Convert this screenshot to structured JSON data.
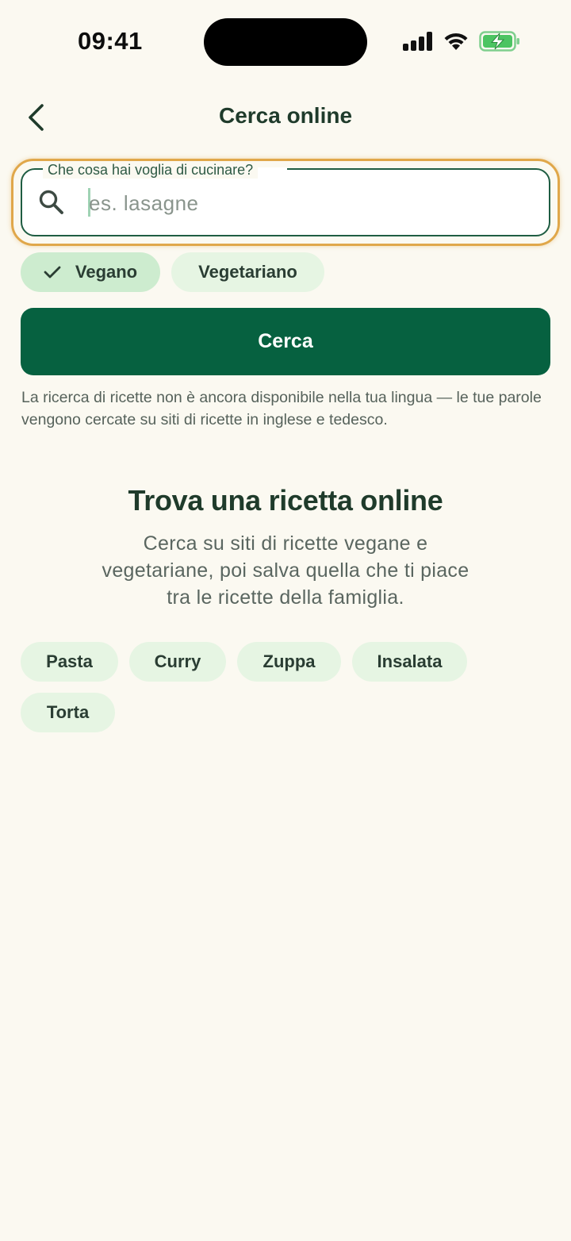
{
  "status_bar": {
    "time": "09:41"
  },
  "header": {
    "title": "Cerca online",
    "back_icon": "chevron-left-icon"
  },
  "search": {
    "label": "Che cosa hai voglia di cucinare?",
    "placeholder": "es. lasagne",
    "value": "",
    "icon": "search-icon"
  },
  "filters": [
    {
      "label": "Vegano",
      "selected": true
    },
    {
      "label": "Vegetariano",
      "selected": false
    }
  ],
  "search_button": {
    "label": "Cerca"
  },
  "note": "La ricerca di ricette non è ancora disponibile nella tua lingua — le tue parole vengono cercate su siti di ricette in inglese e tedesco.",
  "empty_state": {
    "title": "Trova una ricetta online",
    "description": "Cerca su siti di ricette vegane e vegetariane, poi salva quella che ti piace tra le ricette della famiglia."
  },
  "suggestions": [
    "Pasta",
    "Curry",
    "Zuppa",
    "Insalata",
    "Torta"
  ],
  "colors": {
    "background": "#fbf9f1",
    "primary": "#066140",
    "chip_selected": "#cdeccf",
    "chip": "#e6f5e3",
    "focus_ring": "#e0a74a"
  }
}
